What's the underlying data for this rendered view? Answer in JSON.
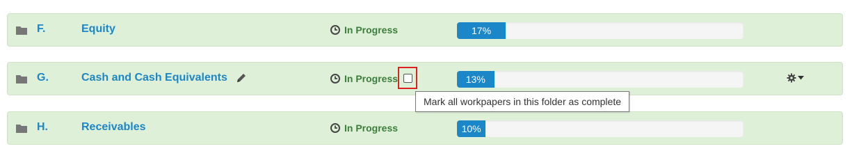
{
  "folders": [
    {
      "letter": "F.",
      "name": "Equity",
      "status": "In Progress",
      "progress_label": "17%",
      "progress": 0.17
    },
    {
      "letter": "G.",
      "name": "Cash and Cash Equivalents",
      "status": "In Progress",
      "progress_label": "13%",
      "progress": 0.13
    },
    {
      "letter": "H.",
      "name": "Receivables",
      "status": "In Progress",
      "progress_label": "10%",
      "progress": 0.1
    }
  ],
  "tooltip": "Mark all workpapers in this folder as complete",
  "icons": {
    "folder": "folder-icon",
    "clock": "clock-icon",
    "pencil": "pencil-icon",
    "gear": "gear-icon",
    "caret": "caret-down-icon"
  },
  "colors": {
    "row_bg": "#dff0d8",
    "link": "#1e86c3",
    "status": "#3c7d3c",
    "progress": "#1b87c9",
    "highlight": "#e02020"
  }
}
